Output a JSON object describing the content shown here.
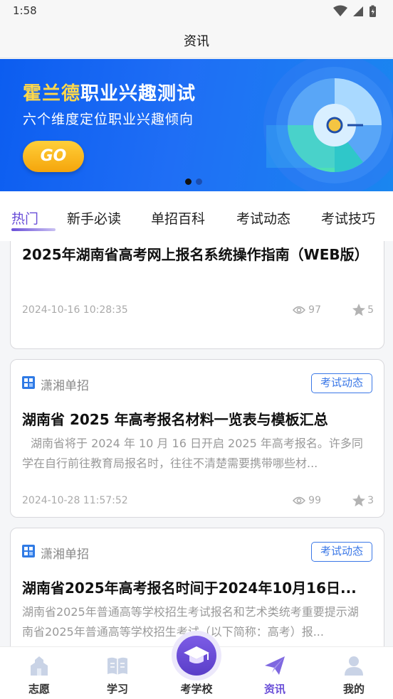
{
  "status_bar": {
    "time": "1:58"
  },
  "header": {
    "title": "资讯"
  },
  "banner": {
    "title_highlight": "霍兰德",
    "title_rest": "职业兴趣测试",
    "subtitle": "六个维度定位职业兴趣倾向",
    "go_label": "GO",
    "page_count": 2,
    "active_page": 1
  },
  "tabs": [
    {
      "label": "热门",
      "active": true
    },
    {
      "label": "新手必读",
      "active": false
    },
    {
      "label": "单招百科",
      "active": false
    },
    {
      "label": "考试动态",
      "active": false
    },
    {
      "label": "考试技巧",
      "active": false
    }
  ],
  "articles": [
    {
      "title": "2025年湖南省高考网上报名系统操作指南（WEB版）",
      "time": "2024-10-16 10:28:35",
      "views": "97",
      "stars": "5"
    },
    {
      "source": "潇湘单招",
      "badge": "考试动态",
      "title": "湖南省 2025 年高考报名材料一览表与模板汇总",
      "summary": "湖南省将于 2024 年 10 月 16 日开启 2025 年高考报名。许多同学在自行前往教育局报名时，往往不清楚需要携带哪些材...",
      "time": "2024-10-28 11:57:52",
      "views": "99",
      "stars": "3"
    },
    {
      "source": "潇湘单招",
      "badge": "考试动态",
      "title": "湖南省2025年高考报名时间于2024年10月16日...",
      "summary": "湖南省2025年普通高等学校招生考试报名和艺术类统考重要提示湖南省2025年普通高等学校招生考试（以下简称：高考）报...",
      "time": "",
      "views": "",
      "stars": ""
    }
  ],
  "bottom_nav": [
    {
      "label": "志愿",
      "icon": "building-icon",
      "active": false
    },
    {
      "label": "学习",
      "icon": "book-icon",
      "active": false
    },
    {
      "label": "考学校",
      "icon": "graduation-cap-icon",
      "active": false
    },
    {
      "label": "资讯",
      "icon": "paper-plane-icon",
      "active": true
    },
    {
      "label": "我的",
      "icon": "user-icon",
      "active": false
    }
  ],
  "colors": {
    "accent": "#6a4fd8",
    "badge_blue": "#3b78e7",
    "banner_blue": "#1f6ef5",
    "go_yellow": "#f5a50b"
  }
}
